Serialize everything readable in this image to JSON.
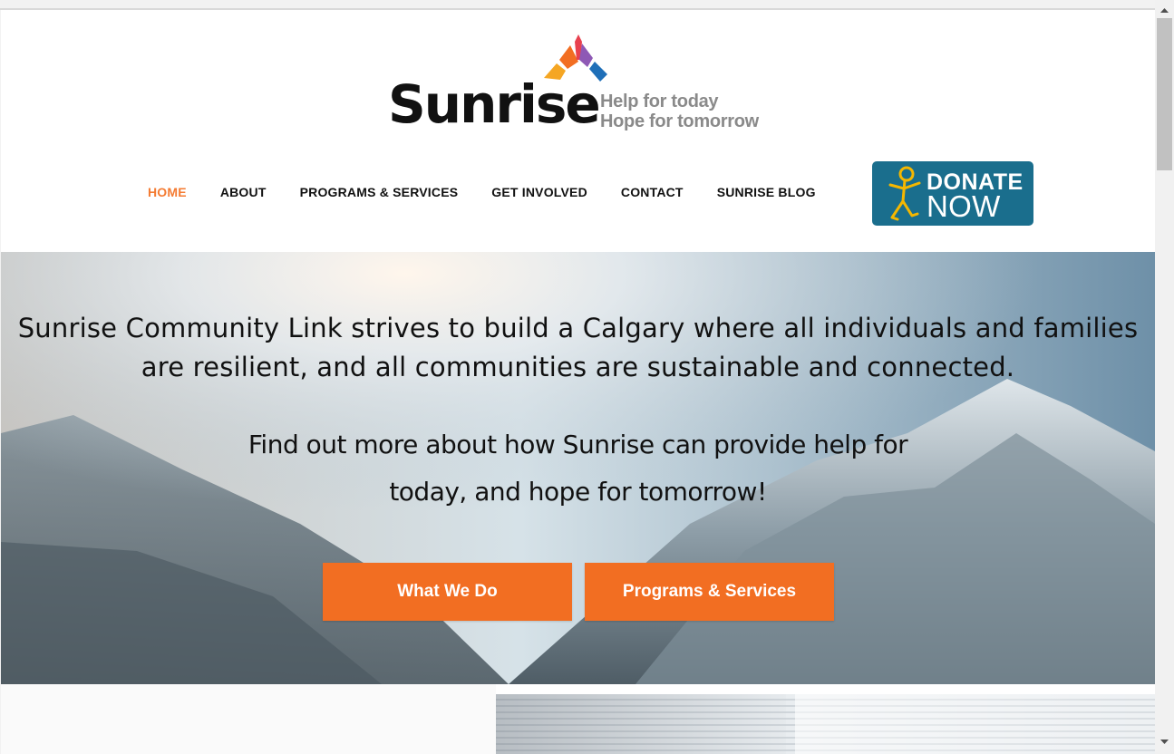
{
  "logo": {
    "wordmark": "Sunrise",
    "tagline_1": "Help for today",
    "tagline_2": "Hope for tomorrow"
  },
  "nav": {
    "items": [
      {
        "label": "HOME",
        "active": true
      },
      {
        "label": "ABOUT"
      },
      {
        "label": "PROGRAMS & SERVICES"
      },
      {
        "label": "GET INVOLVED"
      },
      {
        "label": "CONTACT"
      },
      {
        "label": "SUNRISE BLOG"
      }
    ],
    "active_color": "#f47b32"
  },
  "donate": {
    "line1": "DONATE",
    "line2": "NOW",
    "bg_color": "#1a6e8d"
  },
  "hero": {
    "mission_line1": "Sunrise Community Link strives to build a Calgary where all individuals and families",
    "mission_line2": "are resilient, and all communities are sustainable and connected.",
    "subtitle_line1": "Find out more about how Sunrise can provide help for",
    "subtitle_line2": "today, and hope for tomorrow!",
    "buttons": {
      "what_we_do": "What We Do",
      "programs": "Programs & Services"
    },
    "button_color": "#f26e22"
  }
}
